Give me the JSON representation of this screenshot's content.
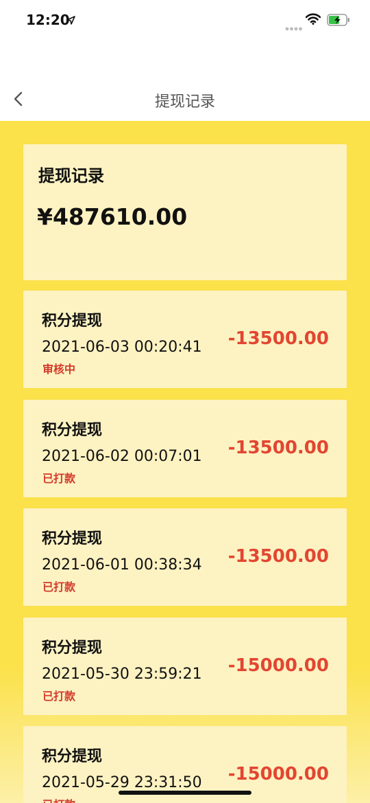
{
  "status_bar": {
    "time": "12:20"
  },
  "nav": {
    "title": "提现记录"
  },
  "summary": {
    "title": "提现记录",
    "amount": "¥487610.00"
  },
  "records": [
    {
      "title": "积分提现",
      "time": "2021-06-03 00:20:41",
      "status": "审核中",
      "amount": "-13500.00"
    },
    {
      "title": "积分提现",
      "time": "2021-06-02 00:07:01",
      "status": "已打款",
      "amount": "-13500.00"
    },
    {
      "title": "积分提现",
      "time": "2021-06-01 00:38:34",
      "status": "已打款",
      "amount": "-13500.00"
    },
    {
      "title": "积分提现",
      "time": "2021-05-30 23:59:21",
      "status": "已打款",
      "amount": "-15000.00"
    },
    {
      "title": "积分提现",
      "time": "2021-05-29 23:31:50",
      "status": "已打款",
      "amount": "-15000.00"
    }
  ],
  "colors": {
    "background": "#fbe14a",
    "card": "#fdf2c2",
    "amount_red": "#e24631",
    "status_red": "#d23a2a"
  },
  "icons": {
    "location": "location-arrow-icon",
    "signal": "signal-dots-icon",
    "wifi": "wifi-icon",
    "battery": "battery-charging-icon",
    "back": "chevron-left-icon"
  }
}
